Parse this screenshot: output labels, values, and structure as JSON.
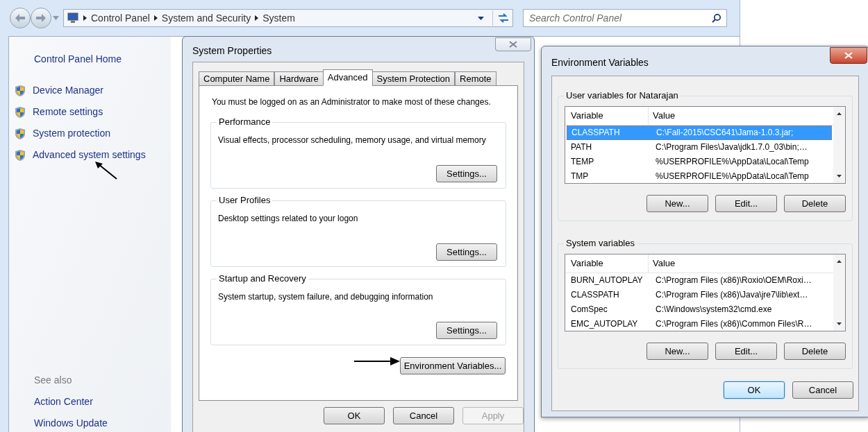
{
  "explorer": {
    "breadcrumb": [
      "Control Panel",
      "System and Security",
      "System"
    ],
    "search": {
      "placeholder": "Search Control Panel"
    },
    "sidebar": {
      "home": "Control Panel Home",
      "links": [
        "Device Manager",
        "Remote settings",
        "System protection",
        "Advanced system settings"
      ],
      "see_also": "See also",
      "see_also_links": [
        "Action Center",
        "Windows Update"
      ]
    }
  },
  "system_properties": {
    "title": "System Properties",
    "tabs": [
      {
        "label": "Computer Name",
        "selected": false
      },
      {
        "label": "Hardware",
        "selected": false
      },
      {
        "label": "Advanced",
        "selected": true
      },
      {
        "label": "System Protection",
        "selected": false
      },
      {
        "label": "Remote",
        "selected": false
      }
    ],
    "notice": "You must be logged on as an Administrator to make most of these changes.",
    "groups": [
      {
        "title": "Performance",
        "description": "Visual effects, processor scheduling, memory usage, and virtual memory",
        "button": "Settings..."
      },
      {
        "title": "User Profiles",
        "description": "Desktop settings related to your logon",
        "button": "Settings..."
      },
      {
        "title": "Startup and Recovery",
        "description": "System startup, system failure, and debugging information",
        "button": "Settings..."
      }
    ],
    "env_button": "Environment Variables...",
    "buttons": [
      {
        "label": "OK",
        "disabled": false
      },
      {
        "label": "Cancel",
        "disabled": false
      },
      {
        "label": "Apply",
        "disabled": true
      }
    ]
  },
  "environment_variables": {
    "title": "Environment Variables",
    "sections": [
      {
        "title": "User variables for Natarajan",
        "columns": [
          "Variable",
          "Value"
        ],
        "rows": [
          {
            "variable": "CLASSPATH",
            "value": "C:\\Fall-2015\\CSC641\\Jama-1.0.3.jar;",
            "selected": true
          },
          {
            "variable": "PATH",
            "value": "C:\\Program Files\\Java\\jdk1.7.0_03\\bin;…",
            "selected": false
          },
          {
            "variable": "TEMP",
            "value": "%USERPROFILE%\\AppData\\Local\\Temp",
            "selected": false
          },
          {
            "variable": "TMP",
            "value": "%USERPROFILE%\\AppData\\Local\\Temp",
            "selected": false
          }
        ],
        "buttons": [
          "New...",
          "Edit...",
          "Delete"
        ]
      },
      {
        "title": "System variables",
        "columns": [
          "Variable",
          "Value"
        ],
        "rows": [
          {
            "variable": "BURN_AUTOPLAY",
            "value": "C:\\Program Files (x86)\\Roxio\\OEM\\Roxi…",
            "selected": false
          },
          {
            "variable": "CLASSPATH",
            "value": "C:\\Program Files (x86)\\Java\\jre7\\lib\\ext…",
            "selected": false
          },
          {
            "variable": "ComSpec",
            "value": "C:\\Windows\\system32\\cmd.exe",
            "selected": false
          },
          {
            "variable": "EMC_AUTOPLAY",
            "value": "C:\\Program Files (x86)\\Common Files\\R…",
            "selected": false
          }
        ],
        "buttons": [
          "New...",
          "Edit...",
          "Delete"
        ]
      }
    ],
    "buttons": [
      {
        "label": "OK",
        "default": true
      },
      {
        "label": "Cancel",
        "default": false
      }
    ]
  }
}
